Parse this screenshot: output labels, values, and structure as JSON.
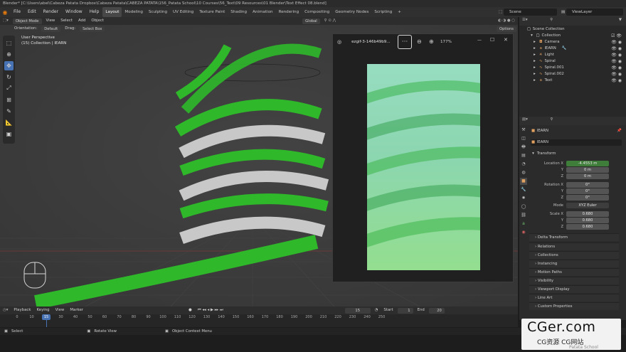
{
  "window": {
    "title": "Blender* [C:\\Users\\abel\\Cabeza Patata Dropbox\\Cabeza Patata\\CABEZA PATATA\\156_Patata School\\10 Courses\\56_Text\\09 Resources\\01 Blender\\Text Effect 08.blend]"
  },
  "menubar": {
    "items": [
      "File",
      "Edit",
      "Render",
      "Window",
      "Help"
    ],
    "workspaces": [
      "Layout",
      "Modeling",
      "Sculpting",
      "UV Editing",
      "Texture Paint",
      "Shading",
      "Animation",
      "Rendering",
      "Compositing",
      "Geometry Nodes",
      "Scripting"
    ],
    "active_workspace": "Layout",
    "add_tab": "+",
    "scene": "Scene",
    "view_layer": "ViewLayer"
  },
  "viewport_header": {
    "mode": "Object Mode",
    "menus": [
      "View",
      "Select",
      "Add",
      "Object"
    ],
    "orientation": "Global",
    "options": "Options"
  },
  "viewport_header2": {
    "orientation_label": "Orientation:",
    "orientation_value": "Default",
    "drag_label": "Drag:",
    "drag_value": "Select Box"
  },
  "viewport_info": {
    "line1": "User Perspective",
    "line2": "(15) Collection | lEARN"
  },
  "image_viewer": {
    "filename": "ezgif-3-146b49b9...",
    "more": "···",
    "zoom": "177%",
    "minimize": "—",
    "maximize": "☐",
    "close": "✕"
  },
  "outliner": {
    "root": "Scene Collection",
    "collection": "Collection",
    "items": [
      "Camera",
      "lEARN",
      "Light",
      "Spiral",
      "Spiral.001",
      "Spiral.002",
      "Text"
    ]
  },
  "properties": {
    "object_name": "lEARN",
    "object_data": "lEARN",
    "transform_header": "Transform",
    "location_label": "Location X",
    "location": {
      "x": "-4.4553 m",
      "y": "0 m",
      "z": "0 m"
    },
    "rotation_label": "Rotation X",
    "rotation": {
      "x": "0°",
      "y": "0°",
      "z": "0°"
    },
    "mode_label": "Mode",
    "mode_value": "XYZ Euler",
    "scale_label": "Scale X",
    "scale": {
      "x": "0.680",
      "y": "0.680",
      "z": "0.680"
    },
    "y_label": "Y",
    "z_label": "Z",
    "panels": [
      "Delta Transform",
      "Relations",
      "Collections",
      "Instancing",
      "Motion Paths",
      "Visibility",
      "Viewport Display",
      "Line Art",
      "Custom Properties"
    ]
  },
  "timeline": {
    "menus": [
      "Playback",
      "Keying",
      "View",
      "Marker"
    ],
    "current_frame": "15",
    "start_label": "Start",
    "start": "1",
    "end_label": "End",
    "end": "20",
    "ticks": [
      "0",
      "10",
      "20",
      "30",
      "40",
      "50",
      "60",
      "70",
      "80",
      "90",
      "100",
      "110",
      "120",
      "130",
      "140",
      "150",
      "160",
      "170",
      "180",
      "190",
      "200",
      "210",
      "220",
      "230",
      "240",
      "250"
    ]
  },
  "statusbar": {
    "select": "Select",
    "rotate": "Rotate View",
    "context": "Object Context Menu"
  },
  "watermark": {
    "title": "CGer.com",
    "subtitle": "CG资源 CG网站"
  },
  "credit": "Patata School",
  "colors": {
    "accent": "#4772b3",
    "green_text": "#35d12f",
    "white_text": "#d8d8d8",
    "location_field": "#3f7d3a"
  }
}
